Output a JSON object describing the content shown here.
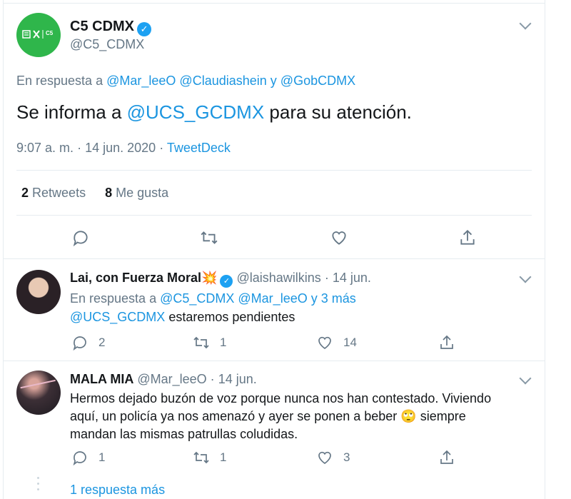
{
  "main_tweet": {
    "display_name": "C5 CDMX",
    "handle": "@C5_CDMX",
    "avatar_text": "C5",
    "reply_prefix": "En respuesta a",
    "reply_user_1": "@Mar_leeO",
    "reply_user_2": "@Claudiashein",
    "reply_conj": "y",
    "reply_user_3": "@GobCDMX",
    "text_before": "Se informa a",
    "text_mention": "@UCS_GCDMX",
    "text_after": "para su atención.",
    "time": "9:07 a. m.",
    "sep": "·",
    "date": "14 jun. 2020",
    "source": "TweetDeck",
    "retweets_count": "2",
    "retweets_label": "Retweets",
    "likes_count": "8",
    "likes_label": "Me gusta"
  },
  "replies": [
    {
      "display_name": "Lai, con Fuerza Moral",
      "emoji": "💥",
      "handle": "@laishawilkins",
      "sep": "·",
      "date": "14 jun.",
      "reply_prefix": "En respuesta a",
      "reply_user_1": "@C5_CDMX",
      "reply_user_2": "@Mar_leeO",
      "reply_more": "y 3 más",
      "text_mention": "@UCS_GCDMX",
      "text": "estaremos pendientes",
      "reply_count": "2",
      "retweet_count": "1",
      "like_count": "14"
    },
    {
      "display_name": "MALA MIA",
      "handle": "@Mar_leeO",
      "sep": "·",
      "date": "14 jun.",
      "text_line_1": "Hermos dejado buzón de voz porque nunca nos han contestado. Viviendo",
      "text_line_2a": "aquí, un policía ya nos amenazó y ayer se ponen a beber",
      "emoji": "🙄",
      "text_line_2b": "siempre",
      "text_line_3": "mandan las mismas patrullas coludidas.",
      "reply_count": "1",
      "retweet_count": "1",
      "like_count": "3"
    }
  ],
  "more_replies": "1 respuesta más",
  "colors": {
    "accent": "#1b95e0",
    "avatar_green": "#2fb64b",
    "muted": "#657786"
  },
  "icons": [
    "reply-icon",
    "retweet-icon",
    "like-icon",
    "share-icon",
    "verified-icon",
    "chevron-down-icon"
  ]
}
